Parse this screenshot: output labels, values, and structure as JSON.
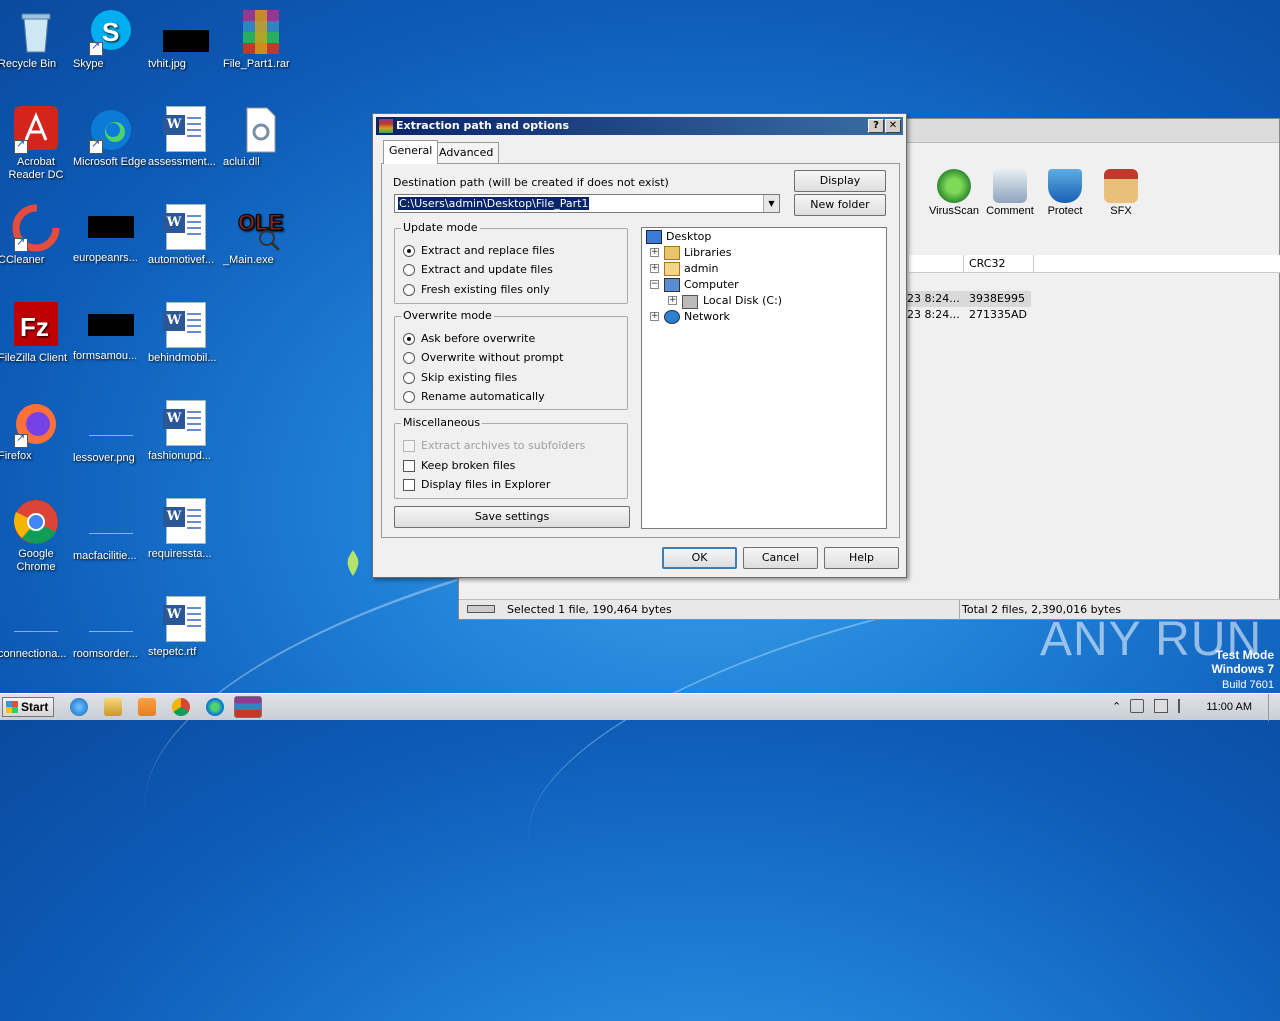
{
  "desktop": {
    "icons": [
      {
        "label": "Recycle Bin"
      },
      {
        "label": "Skype"
      },
      {
        "label": "tvhit.jpg"
      },
      {
        "label": "File_Part1.rar"
      },
      {
        "label": "Acrobat Reader DC"
      },
      {
        "label": "Microsoft Edge"
      },
      {
        "label": "assessment..."
      },
      {
        "label": "aclui.dll"
      },
      {
        "label": "CCleaner"
      },
      {
        "label": "europeanrs..."
      },
      {
        "label": "automotivef..."
      },
      {
        "label": "_Main.exe"
      },
      {
        "label": "FileZilla Client"
      },
      {
        "label": "formsamou..."
      },
      {
        "label": "behindmobil..."
      },
      {
        "label": "Firefox"
      },
      {
        "label": "lessover.png"
      },
      {
        "label": "fashionupd..."
      },
      {
        "label": "Google Chrome"
      },
      {
        "label": "macfacilitie..."
      },
      {
        "label": "requiressta..."
      },
      {
        "label": "connectiona..."
      },
      {
        "label": "roomsorder..."
      },
      {
        "label": "stepetc.rtf"
      }
    ]
  },
  "winrar": {
    "toolbar": [
      {
        "label": "VirusScan",
        "icon": "virusscan-icon"
      },
      {
        "label": "Comment",
        "icon": "comment-icon"
      },
      {
        "label": "Protect",
        "icon": "protect-icon"
      },
      {
        "label": "SFX",
        "icon": "sfx-icon"
      }
    ],
    "columns": {
      "crc": "CRC32"
    },
    "rows": [
      {
        "modified": "23 8:24...",
        "crc": "3938E995"
      },
      {
        "modified": "23 8:24...",
        "crc": "271335AD"
      }
    ],
    "status_left": "Selected 1 file, 190,464 bytes",
    "status_right": "Total 2 files, 2,390,016 bytes"
  },
  "dialog": {
    "title": "Extraction path and options",
    "help_btn": "?",
    "close_btn": "✕",
    "tabs": [
      "General",
      "Advanced"
    ],
    "dest_label": "Destination path (will be created if does not exist)",
    "dest_value": "C:\\Users\\admin\\Desktop\\File_Part1",
    "display_btn": "Display",
    "new_folder_btn": "New folder",
    "update_mode": {
      "title": "Update mode",
      "options": [
        "Extract and replace files",
        "Extract and update files",
        "Fresh existing files only"
      ],
      "selected": 0
    },
    "overwrite_mode": {
      "title": "Overwrite mode",
      "options": [
        "Ask before overwrite",
        "Overwrite without prompt",
        "Skip existing files",
        "Rename automatically"
      ],
      "selected": 0
    },
    "misc": {
      "title": "Miscellaneous",
      "options": [
        "Extract archives to subfolders",
        "Keep broken files",
        "Display files in Explorer"
      ]
    },
    "save_btn": "Save settings",
    "tree": [
      "Desktop",
      "Libraries",
      "admin",
      "Computer",
      "Local Disk (C:)",
      "Network"
    ],
    "ok_btn": "OK",
    "cancel_btn": "Cancel",
    "help_button": "Help"
  },
  "taskbar": {
    "start": "Start",
    "clock": "11:00 AM"
  },
  "watermark": "ANY RUN",
  "test_mode": {
    "line1": "Test Mode",
    "line2": "Windows 7",
    "line3": "Build 7601"
  },
  "colors": {
    "titlebar": "#0a246a",
    "desktop": "#1f7fd6",
    "selection": "#0a246a"
  }
}
